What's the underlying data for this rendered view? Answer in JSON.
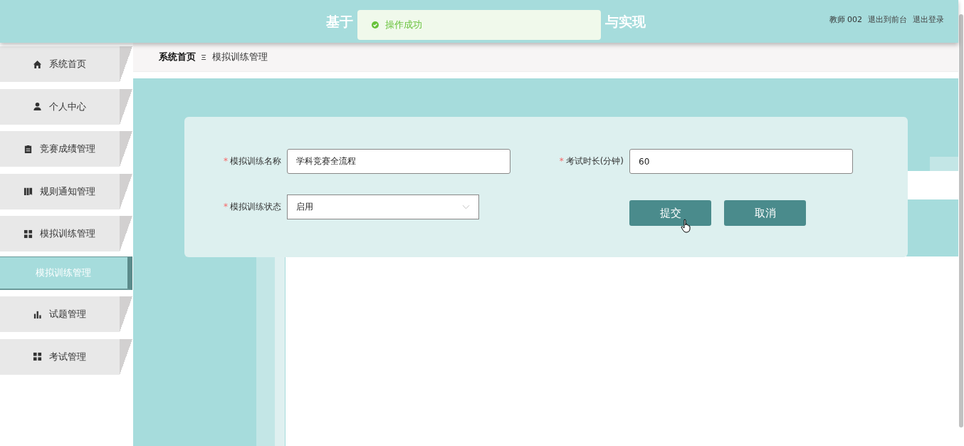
{
  "header": {
    "title_start": "基于",
    "title_end": "与实现",
    "user": "教师 002",
    "links": [
      "退出到前台",
      "退出登录"
    ]
  },
  "toast": {
    "kind": "success",
    "message": "操作成功"
  },
  "sidebar": {
    "items": [
      {
        "label": "系统首页",
        "selected": false
      },
      {
        "label": "个人中心",
        "selected": false
      },
      {
        "label": "竞赛成绩管理",
        "selected": false
      },
      {
        "label": "规则通知管理",
        "selected": false
      },
      {
        "label": "模拟训练管理",
        "selected": false
      },
      {
        "label": "模拟训练管理",
        "selected": true
      },
      {
        "label": "试题管理",
        "selected": false
      },
      {
        "label": "考试管理",
        "selected": false
      }
    ]
  },
  "breadcrumb": [
    "系统首页",
    "模拟训练管理"
  ],
  "form": {
    "fields": [
      {
        "kind": "input",
        "label": "模拟训练名称",
        "required_mark": "*",
        "value": "学科竞赛全流程"
      },
      {
        "kind": "input",
        "label": "考试时长(分钟)",
        "required_mark": "*",
        "value": "60"
      },
      {
        "kind": "select",
        "label": "模拟训练状态",
        "required_mark": "*",
        "value": "启用"
      }
    ],
    "buttons": [
      "提交",
      "取消"
    ]
  }
}
